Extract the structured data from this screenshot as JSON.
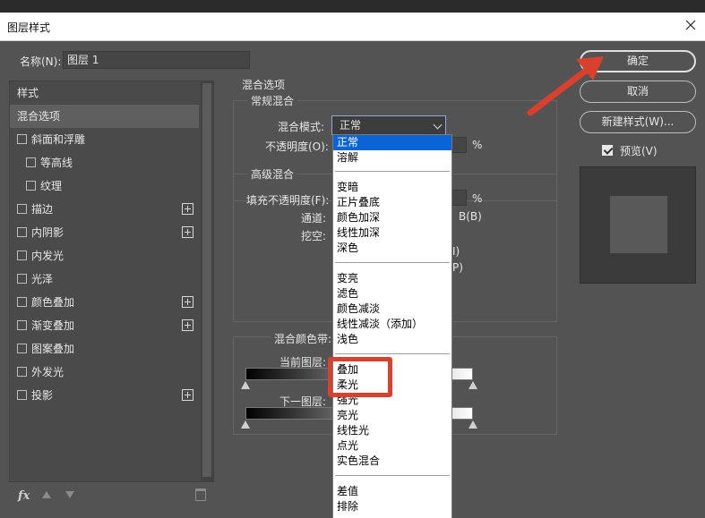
{
  "window": {
    "title": "图层样式"
  },
  "name_field": {
    "label": "名称(N):",
    "value": "图层 1"
  },
  "style_list": {
    "header": "样式",
    "items": [
      {
        "label": "混合选项",
        "checkbox": false,
        "plus": false,
        "selected": true,
        "indent": false
      },
      {
        "label": "斜面和浮雕",
        "checkbox": true,
        "plus": false,
        "selected": false,
        "indent": false
      },
      {
        "label": "等高线",
        "checkbox": true,
        "plus": false,
        "selected": false,
        "indent": true
      },
      {
        "label": "纹理",
        "checkbox": true,
        "plus": false,
        "selected": false,
        "indent": true
      },
      {
        "label": "描边",
        "checkbox": true,
        "plus": true,
        "selected": false,
        "indent": false
      },
      {
        "label": "内阴影",
        "checkbox": true,
        "plus": true,
        "selected": false,
        "indent": false
      },
      {
        "label": "内发光",
        "checkbox": true,
        "plus": false,
        "selected": false,
        "indent": false
      },
      {
        "label": "光泽",
        "checkbox": true,
        "plus": false,
        "selected": false,
        "indent": false
      },
      {
        "label": "颜色叠加",
        "checkbox": true,
        "plus": true,
        "selected": false,
        "indent": false
      },
      {
        "label": "渐变叠加",
        "checkbox": true,
        "plus": true,
        "selected": false,
        "indent": false
      },
      {
        "label": "图案叠加",
        "checkbox": true,
        "plus": false,
        "selected": false,
        "indent": false
      },
      {
        "label": "外发光",
        "checkbox": true,
        "plus": false,
        "selected": false,
        "indent": false
      },
      {
        "label": "投影",
        "checkbox": true,
        "plus": true,
        "selected": false,
        "indent": false
      }
    ],
    "fx_label": "fx"
  },
  "blend_options": {
    "section_title": "混合选项",
    "normal_group_title": "常规混合",
    "blend_mode_label": "混合模式:",
    "blend_mode_value": "正常",
    "opacity_label": "不透明度(O):",
    "opacity_unit": "%",
    "advanced_group_title": "高级混合",
    "fill_opacity_label": "填充不透明度(F):",
    "fill_opacity_unit": "%",
    "channels_label": "通道:",
    "channel_b": "B(B)",
    "knockout_label": "挖空:",
    "frag1": "I)",
    "frag2": "P)",
    "blend_if_label": "混合颜色带:",
    "this_layer_label": "当前图层:",
    "underlying_layer_label": "下一图层:"
  },
  "blend_dropdown": {
    "items": [
      "正常",
      "溶解",
      "变暗",
      "正片叠底",
      "颜色加深",
      "线性加深",
      "深色",
      "变亮",
      "滤色",
      "颜色减淡",
      "线性减淡（添加）",
      "浅色",
      "叠加",
      "柔光",
      "强光",
      "亮光",
      "线性光",
      "点光",
      "实色混合",
      "差值",
      "排除"
    ],
    "selected": "正常",
    "highlighted": [
      "叠加",
      "柔光"
    ]
  },
  "buttons": {
    "ok": "确定",
    "cancel": "取消",
    "new_style": "新建样式(W)..."
  },
  "preview": {
    "label": "预览(V)",
    "checked": true
  },
  "colors": {
    "annotation": "#d9412e",
    "selection": "#0a64d6"
  }
}
